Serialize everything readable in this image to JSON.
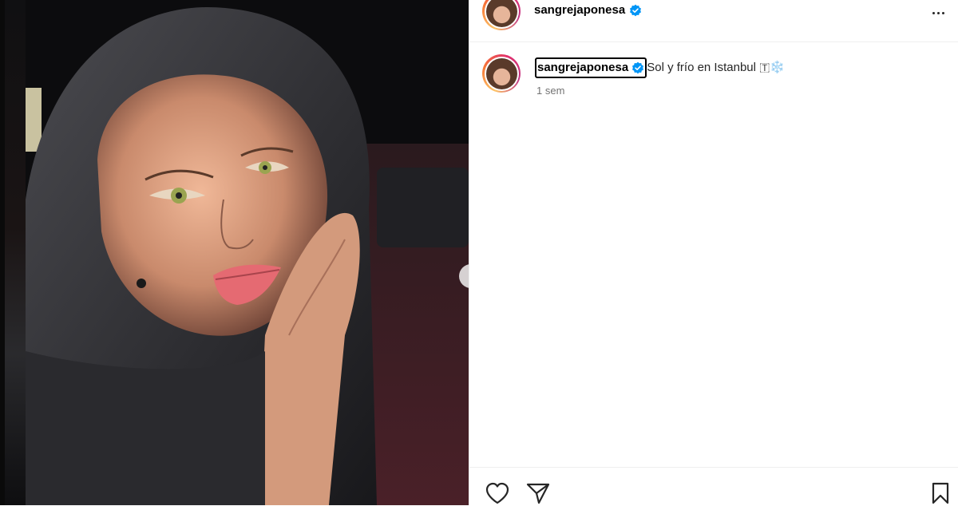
{
  "post": {
    "username": "sangrejaponesa",
    "verified": true,
    "caption_user": "sangrejaponesa",
    "caption_text": "Sol y frío en Istanbul 🇹❄️",
    "timestamp": "1 sem"
  },
  "icons": {
    "more": "more-options-icon",
    "like": "heart-icon",
    "share": "send-icon",
    "save": "bookmark-icon",
    "next": "chevron-right-icon",
    "verified": "verified-badge-icon"
  },
  "colors": {
    "verified_blue": "#0095f6",
    "story_ring": "#e1306c",
    "secondary_text": "#737373"
  }
}
